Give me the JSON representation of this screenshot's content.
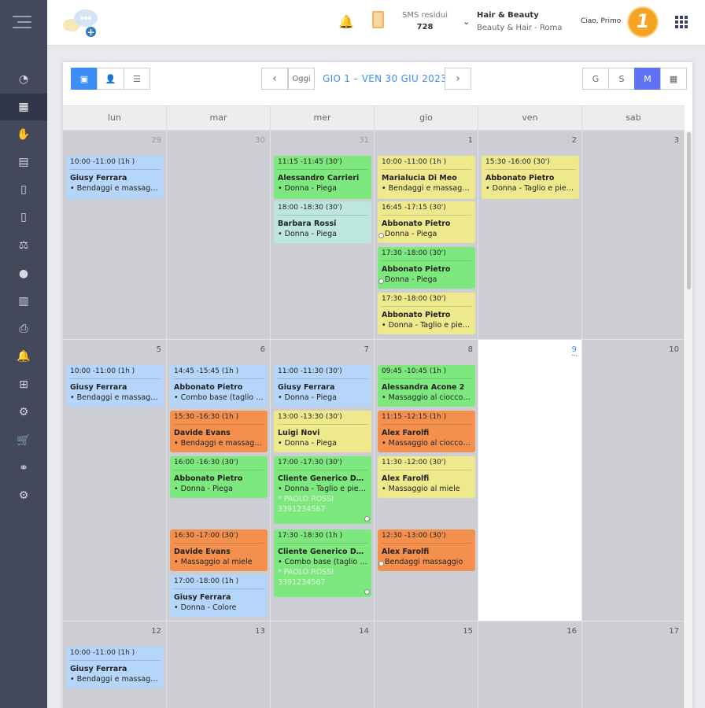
{
  "sidebar": {
    "items": [
      {
        "icon": "pie-chart-icon",
        "glyph": "◔"
      },
      {
        "icon": "calendar-icon",
        "glyph": "▦",
        "active": true
      },
      {
        "icon": "hand-icon",
        "glyph": "✋"
      },
      {
        "icon": "id-card-icon",
        "glyph": "▤"
      },
      {
        "icon": "document-icon",
        "glyph": "▯"
      },
      {
        "icon": "invoice-icon",
        "glyph": "▯"
      },
      {
        "icon": "balance-icon",
        "glyph": "⚖"
      },
      {
        "icon": "piggy-bank-icon",
        "glyph": "●"
      },
      {
        "icon": "warehouse-icon",
        "glyph": "▥"
      },
      {
        "icon": "printer-icon",
        "glyph": "⎙"
      },
      {
        "icon": "bell-icon",
        "glyph": "🔔"
      },
      {
        "icon": "gift-icon",
        "glyph": "⊞"
      },
      {
        "icon": "gear-icon",
        "glyph": "⚙"
      },
      {
        "icon": "cart-icon",
        "glyph": "🛒"
      },
      {
        "icon": "handshake-icon",
        "glyph": "⚭"
      },
      {
        "icon": "settings-icon",
        "glyph": "⚙"
      }
    ]
  },
  "header": {
    "sms_label": "SMS residui",
    "sms_value": "728",
    "business_name": "Hair & Beauty",
    "business_location": "Beauty & Hair - Roma",
    "greeting": "Ciao, Primo",
    "avatar_text": "1"
  },
  "toolbar": {
    "prev": "‹",
    "today": "Oggi",
    "next": "›",
    "title": "GIO 1 – VEN 30 GIU 2023",
    "views": [
      "G",
      "S",
      "M"
    ],
    "view_icon_day": "▣",
    "view_icon_staff": "👤",
    "view_icon_list": "☰",
    "view_icon_cal": "▦"
  },
  "days": [
    "lun",
    "mar",
    "mer",
    "gio",
    "ven",
    "sab"
  ],
  "weeks": [
    {
      "nums": [
        "29",
        "30",
        "31",
        "1",
        "2",
        "3"
      ],
      "muted": [
        true,
        true,
        true,
        false,
        false,
        false
      ]
    },
    {
      "nums": [
        "5",
        "6",
        "7",
        "8",
        "9",
        "10"
      ],
      "muted": [
        false,
        false,
        false,
        false,
        false,
        false
      ]
    },
    {
      "nums": [
        "12",
        "13",
        "14",
        "15",
        "16",
        "17"
      ],
      "muted": [
        false,
        false,
        false,
        false,
        false,
        false
      ]
    }
  ],
  "today": {
    "week": 1,
    "col": 4
  },
  "events": [
    {
      "w": 0,
      "d": 0,
      "slot": 0,
      "h": 55,
      "color": "blue",
      "time": "10:00 -11:00 (1h )",
      "name": "Giusy Ferrara",
      "service": "• Bendaggi e massaggio"
    },
    {
      "w": 0,
      "d": 2,
      "slot": 0,
      "h": 55,
      "color": "green",
      "time": "11:15 -11:45 (30')",
      "name": "Alessandro Carrieri",
      "service": "• Donna - Piega"
    },
    {
      "w": 0,
      "d": 2,
      "slot": 1,
      "h": 53,
      "color": "teal",
      "time": "18:00 -18:30 (30')",
      "name": "Barbara Rossi",
      "service": "• Donna - Piega"
    },
    {
      "w": 0,
      "d": 3,
      "slot": 0,
      "h": 55,
      "color": "yellow",
      "time": "10:00 -11:00 (1h )",
      "name": "Marialucia Di Meo",
      "service": "• Bendaggi e massaggio"
    },
    {
      "w": 0,
      "d": 3,
      "slot": 1,
      "h": 53,
      "color": "yellow",
      "time": "16:45 -17:15 (30')",
      "name": "Abbonato Pietro",
      "service": "Donna - Piega",
      "dot": true
    },
    {
      "w": 0,
      "d": 3,
      "slot": 2,
      "h": 53,
      "color": "green",
      "time": "17:30 -18:00 (30')",
      "name": "Abbonato Pietro",
      "service": "Donna - Piega",
      "dot": true
    },
    {
      "w": 0,
      "d": 3,
      "slot": 3,
      "h": 53,
      "color": "yellow",
      "time": "17:30 -18:00 (30')",
      "name": "Abbonato Pietro",
      "service": "• Donna - Taglio e piega"
    },
    {
      "w": 0,
      "d": 4,
      "slot": 0,
      "h": 55,
      "color": "yellow",
      "time": "15:30 -16:00 (30')",
      "name": "Abbonato Pietro",
      "service": "• Donna - Taglio e piega"
    },
    {
      "w": 1,
      "d": 0,
      "slot": 0,
      "h": 53,
      "color": "blue",
      "time": "10:00 -11:00 (1h )",
      "name": "Giusy Ferrara",
      "service": "• Bendaggi e massaggio"
    },
    {
      "w": 1,
      "d": 1,
      "slot": 0,
      "h": 53,
      "color": "blue",
      "time": "14:45 -15:45 (1h )",
      "name": "Abbonato Pietro",
      "service": "• Combo base (taglio + piega)"
    },
    {
      "w": 1,
      "d": 1,
      "slot": 1,
      "h": 53,
      "color": "orange",
      "time": "15:30 -16:30 (1h )",
      "name": "Davide Evans",
      "service": "• Bendaggi e massaggio"
    },
    {
      "w": 1,
      "d": 1,
      "slot": 2,
      "h": 53,
      "color": "green",
      "time": "16:00 -16:30 (30')",
      "name": "Abbonato Pietro",
      "service": "• Donna - Piega"
    },
    {
      "w": 1,
      "d": 1,
      "slot": 3.6,
      "h": 53,
      "color": "orange",
      "time": "16:30 -17:00 (30')",
      "name": "Davide Evans",
      "service": "• Massaggio al miele"
    },
    {
      "w": 1,
      "d": 1,
      "slot": 4.6,
      "h": 53,
      "color": "blue",
      "time": "17:00 -18:00 (1h )",
      "name": "Giusy Ferrara",
      "service": "• Donna - Colore"
    },
    {
      "w": 1,
      "d": 2,
      "slot": 0,
      "h": 53,
      "color": "blue",
      "time": "11:00 -11:30 (30')",
      "name": "Giusy Ferrara",
      "service": "• Donna - Piega"
    },
    {
      "w": 1,
      "d": 2,
      "slot": 1,
      "h": 53,
      "color": "yellow",
      "time": "13:00 -13:30 (30')",
      "name": "Luigi Novi",
      "service": "• Donna - Piega"
    },
    {
      "w": 1,
      "d": 2,
      "slot": 2,
      "h": 86,
      "color": "green",
      "time": "17:00 -17:30 (30')",
      "name": "Cliente Generico Davide",
      "service": "• Donna - Taglio e piega",
      "extra1": "* PAOLO ROSSI",
      "extra2": "3391234567",
      "dotr": true
    },
    {
      "w": 1,
      "d": 2,
      "slot": 3.6,
      "h": 86,
      "color": "green",
      "time": "17:30 -18:30 (1h )",
      "name": "Cliente Generico Davide",
      "service": "• Combo base (taglio + piega)",
      "extra1": "* PAOLO ROSSI",
      "extra2": "3391234567",
      "dotr": true
    },
    {
      "w": 1,
      "d": 3,
      "slot": 0,
      "h": 53,
      "color": "green",
      "time": "09:45 -10:45 (1h )",
      "name": "Alessandra Acone 2",
      "service": "• Massaggio al cioccolato"
    },
    {
      "w": 1,
      "d": 3,
      "slot": 1,
      "h": 53,
      "color": "orange",
      "time": "11:15 -12:15 (1h )",
      "name": "Alex Farolfi",
      "service": "• Massaggio al cioccolato"
    },
    {
      "w": 1,
      "d": 3,
      "slot": 2,
      "h": 53,
      "color": "yellow",
      "time": "11:30 -12:00 (30')",
      "name": "Alex Farolfi",
      "service": "• Massaggio al miele"
    },
    {
      "w": 1,
      "d": 3,
      "slot": 3.6,
      "h": 53,
      "color": "orange",
      "time": "12:30 -13:00 (30')",
      "name": "Alex Farolfi",
      "service": "Bendaggi massaggio",
      "dot": true
    },
    {
      "w": 2,
      "d": 0,
      "slot": 0,
      "h": 53,
      "color": "blue",
      "time": "10:00 -11:00 (1h )",
      "name": "Giusy Ferrara",
      "service": "• Bendaggi e massaggio"
    }
  ]
}
